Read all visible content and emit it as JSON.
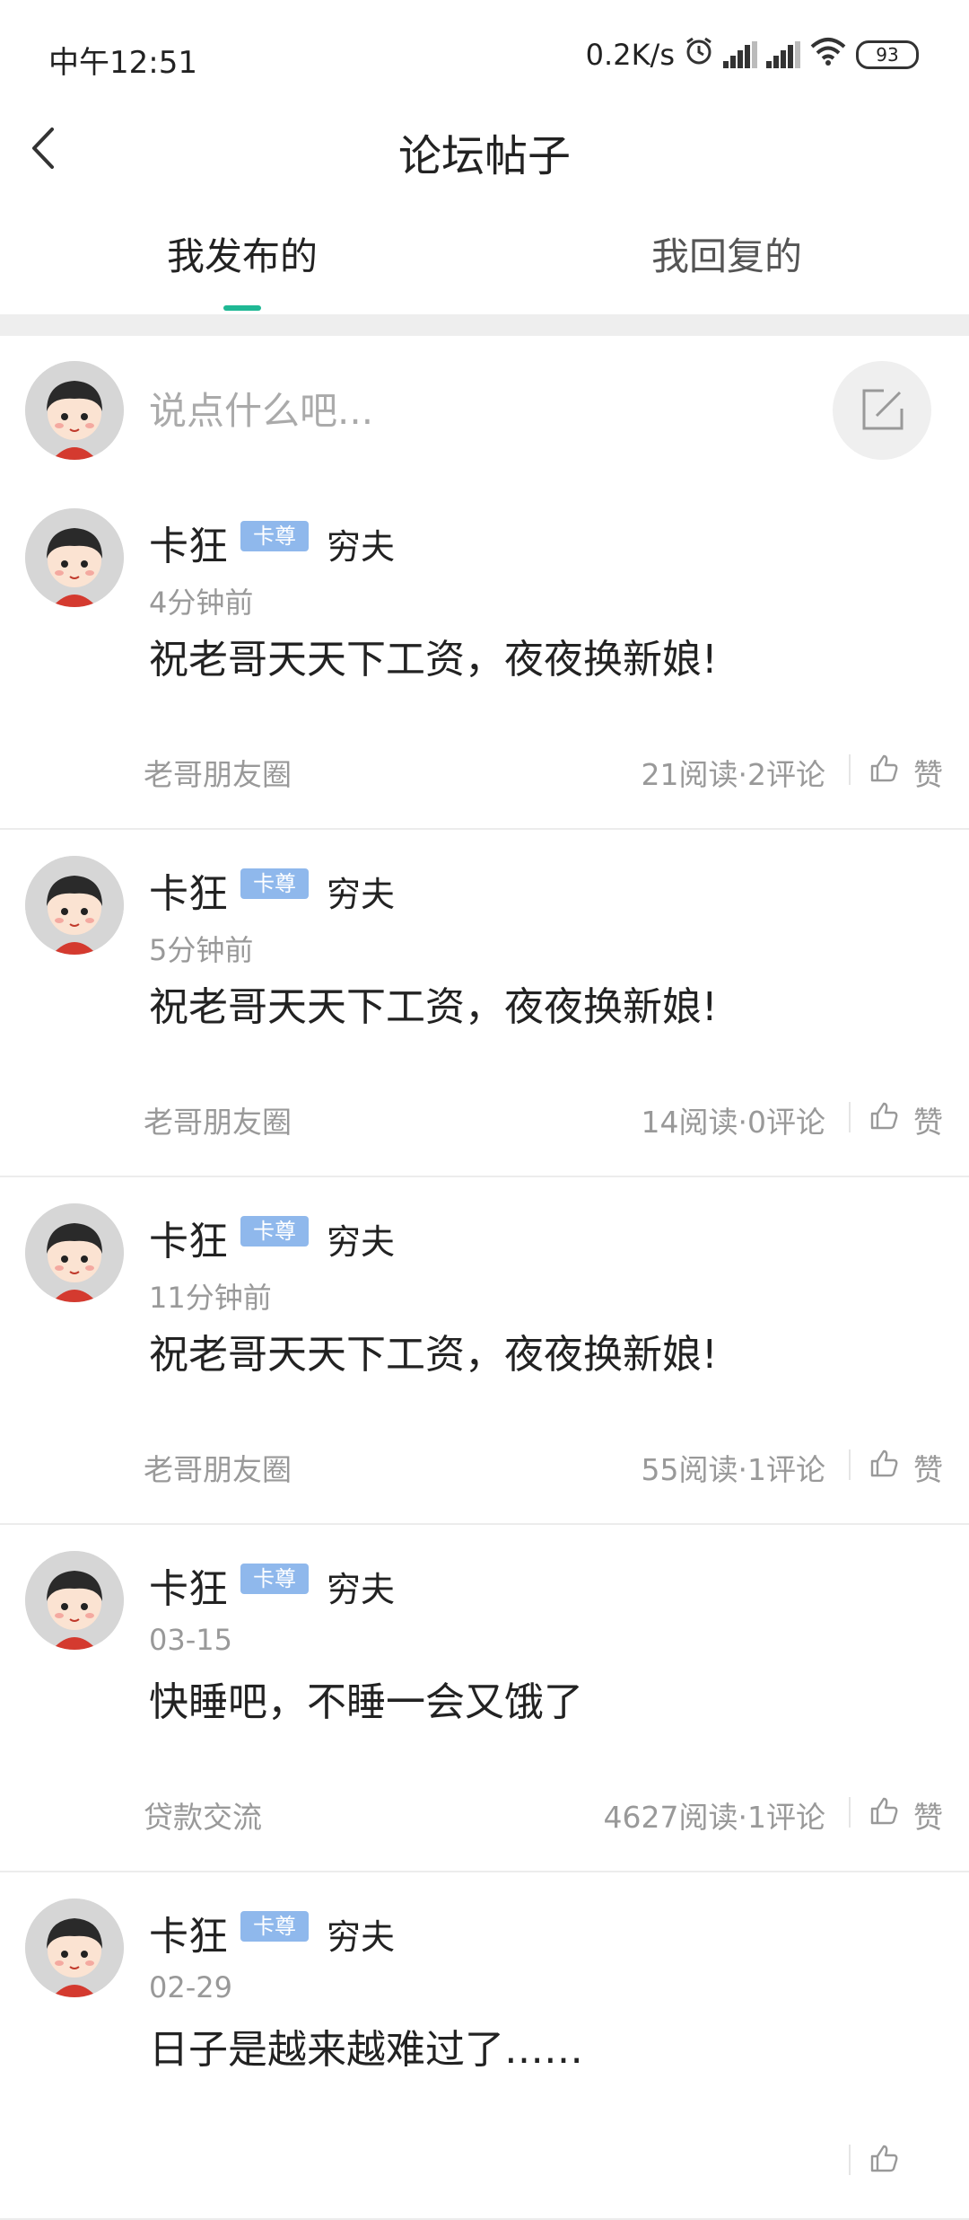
{
  "status_bar": {
    "time": "中午12:51",
    "speed": "0.2K/s",
    "battery": "93"
  },
  "header": {
    "title": "论坛帖子"
  },
  "tabs": [
    {
      "label": "我发布的"
    },
    {
      "label": "我回复的"
    }
  ],
  "composer": {
    "placeholder": "说点什么吧..."
  },
  "posts": [
    {
      "name": "卡狂",
      "badge": "卡尊",
      "user_title": "穷夫",
      "time": "4分钟前",
      "content": "祝老哥天天下工资，夜夜换新娘!",
      "tag": "老哥朋友圈",
      "stats": "21阅读·2评论",
      "like": "赞"
    },
    {
      "name": "卡狂",
      "badge": "卡尊",
      "user_title": "穷夫",
      "time": "5分钟前",
      "content": "祝老哥天天下工资，夜夜换新娘!",
      "tag": "老哥朋友圈",
      "stats": "14阅读·0评论",
      "like": "赞"
    },
    {
      "name": "卡狂",
      "badge": "卡尊",
      "user_title": "穷夫",
      "time": "11分钟前",
      "content": "祝老哥天天下工资，夜夜换新娘!",
      "tag": "老哥朋友圈",
      "stats": "55阅读·1评论",
      "like": "赞"
    },
    {
      "name": "卡狂",
      "badge": "卡尊",
      "user_title": "穷夫",
      "time": "03-15",
      "content": "快睡吧，不睡一会又饿了",
      "tag": "贷款交流",
      "stats": "4627阅读·1评论",
      "like": "赞"
    },
    {
      "name": "卡狂",
      "badge": "卡尊",
      "user_title": "穷夫",
      "time": "02-29",
      "content": "日子是越来越难过了……",
      "tag": "",
      "stats": "",
      "like": ""
    }
  ],
  "colors": {
    "accent": "#1fb894",
    "badge": "#8fb8ec"
  }
}
